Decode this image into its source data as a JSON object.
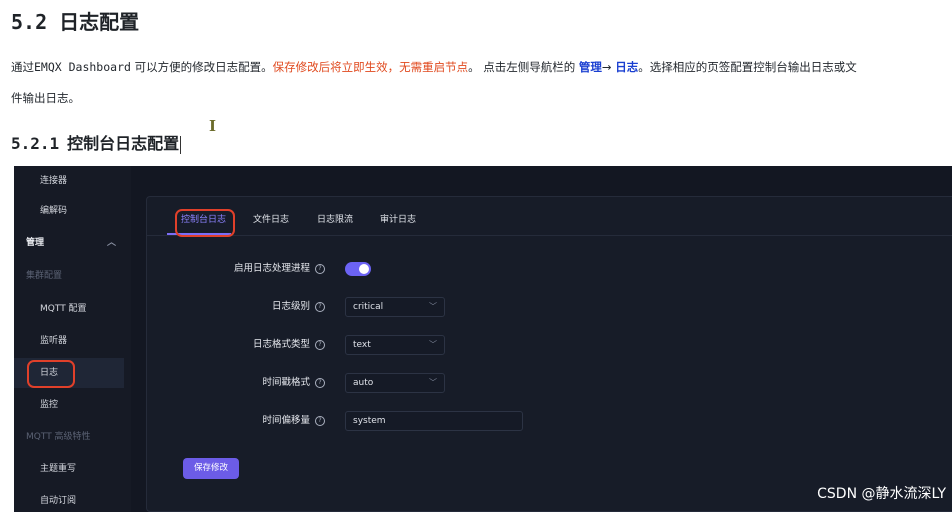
{
  "doc": {
    "section_num": "5.2",
    "section_title": "日志配置",
    "para_prefix": "通过",
    "para_mono": "EMQX Dashboard",
    "para_mid": " 可以方便的修改日志配置。",
    "para_red": "保存修改后将立即生效，无需重启节点",
    "para_after_red": "。 点击左侧导航栏的 ",
    "para_link1": "管理",
    "para_arrow": "→ ",
    "para_link2": "日志",
    "para_tail": "。选择相应的页签配置控制台输出日志或文",
    "para_line2": "件输出日志。",
    "subsection_num": "5.2.1",
    "subsection_title": "控制台日志配置",
    "cursor_glyph": "I"
  },
  "sidebar": {
    "items": [
      {
        "label": "连接器"
      },
      {
        "label": "编解码"
      },
      {
        "label": "管理"
      },
      {
        "label": "集群配置"
      },
      {
        "label": "MQTT 配置"
      },
      {
        "label": "监听器"
      },
      {
        "label": "日志"
      },
      {
        "label": "监控"
      },
      {
        "label": "MQTT 高级特性"
      },
      {
        "label": "主题重写"
      },
      {
        "label": "自动订阅"
      }
    ],
    "chevron_icon": "chevron-up-icon"
  },
  "tabs": [
    {
      "label": "控制台日志",
      "active": true
    },
    {
      "label": "文件日志",
      "active": false
    },
    {
      "label": "日志限流",
      "active": false
    },
    {
      "label": "审计日志",
      "active": false
    }
  ],
  "form": {
    "enable_label": "启用日志处理进程",
    "enable_value": true,
    "level_label": "日志级别",
    "level_value": "critical",
    "format_label": "日志格式类型",
    "format_value": "text",
    "timestamp_label": "时间戳格式",
    "timestamp_value": "auto",
    "offset_label": "时间偏移量",
    "offset_value": "system",
    "help_glyph": "?",
    "save_label": "保存修改"
  },
  "watermark": "CSDN @静水流深LY",
  "colors": {
    "accent": "#6c5ce7",
    "highlight_red": "#e04a1f",
    "link_blue": "#1a3fd1",
    "annotation_circle": "#e0402a"
  }
}
